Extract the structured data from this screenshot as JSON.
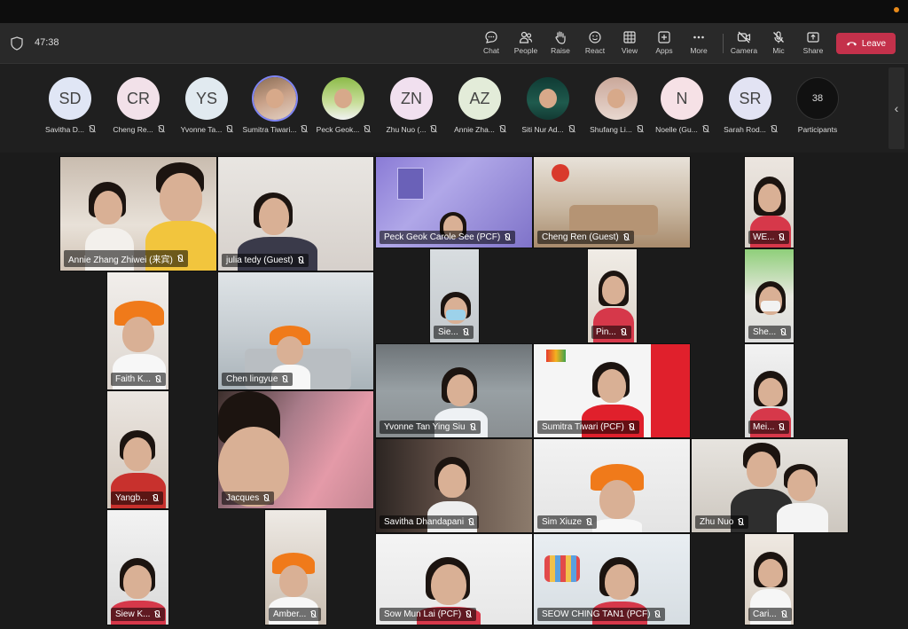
{
  "meeting": {
    "timer": "47:38"
  },
  "toolbar": {
    "chat": "Chat",
    "people": "People",
    "raise": "Raise",
    "react": "React",
    "view": "View",
    "apps": "Apps",
    "more": "More",
    "camera": "Camera",
    "mic": "Mic",
    "share": "Share",
    "leave": "Leave"
  },
  "attendees": [
    {
      "initials": "SD",
      "name": "Savitha D...",
      "color": "#e0e6f5"
    },
    {
      "initials": "CR",
      "name": "Cheng Re...",
      "color": "#f2e1e9"
    },
    {
      "initials": "YS",
      "name": "Yvonne Ta...",
      "color": "#e1eaf0"
    },
    {
      "initials": "",
      "name": "Sumitra Tiwari...",
      "color": "#c9a28a"
    },
    {
      "initials": "",
      "name": "Peck Geok...",
      "color": "#a7c96a"
    },
    {
      "initials": "ZN",
      "name": "Zhu Nuo (...",
      "color": "#f1e0ef"
    },
    {
      "initials": "AZ",
      "name": "Annie Zha...",
      "color": "#e3ecd9"
    },
    {
      "initials": "",
      "name": "Siti Nur Ad...",
      "color": "#1f4f45"
    },
    {
      "initials": "",
      "name": "Shufang Li...",
      "color": "#d7c2b8"
    },
    {
      "initials": "N",
      "name": "Noelle (Gu...",
      "color": "#f6e1e6"
    },
    {
      "initials": "SR",
      "name": "Sarah Rod...",
      "color": "#e2e3f3"
    }
  ],
  "participants": {
    "count": "38",
    "label": "Participants"
  },
  "tiles": [
    "Annie  Zhang Zhiwei (来宾)",
    "julia tedy (Guest)",
    "Peck Geok Carole See (PCF)",
    "Cheng Ren (Guest)",
    "WE...",
    "Sie...",
    "Pin...",
    "Faith K...",
    "She...",
    "Chen lingyue",
    "Yvonne Tan Ying Siu",
    "Sumitra Tiwari (PCF)",
    "Mei...",
    "Yangb...",
    "Jacques",
    "Savitha Dhandapani",
    "Sim Xiuze",
    "Zhu Nuo",
    "Siew K...",
    "Amber...",
    "Sow Mun Lai (PCF)",
    "SEOW CHING TAN1 (PCF)",
    "Cari..."
  ],
  "colors": {
    "leave": "#c4314b",
    "active_ring": "#7f85f5",
    "toolbar": "#292929"
  }
}
